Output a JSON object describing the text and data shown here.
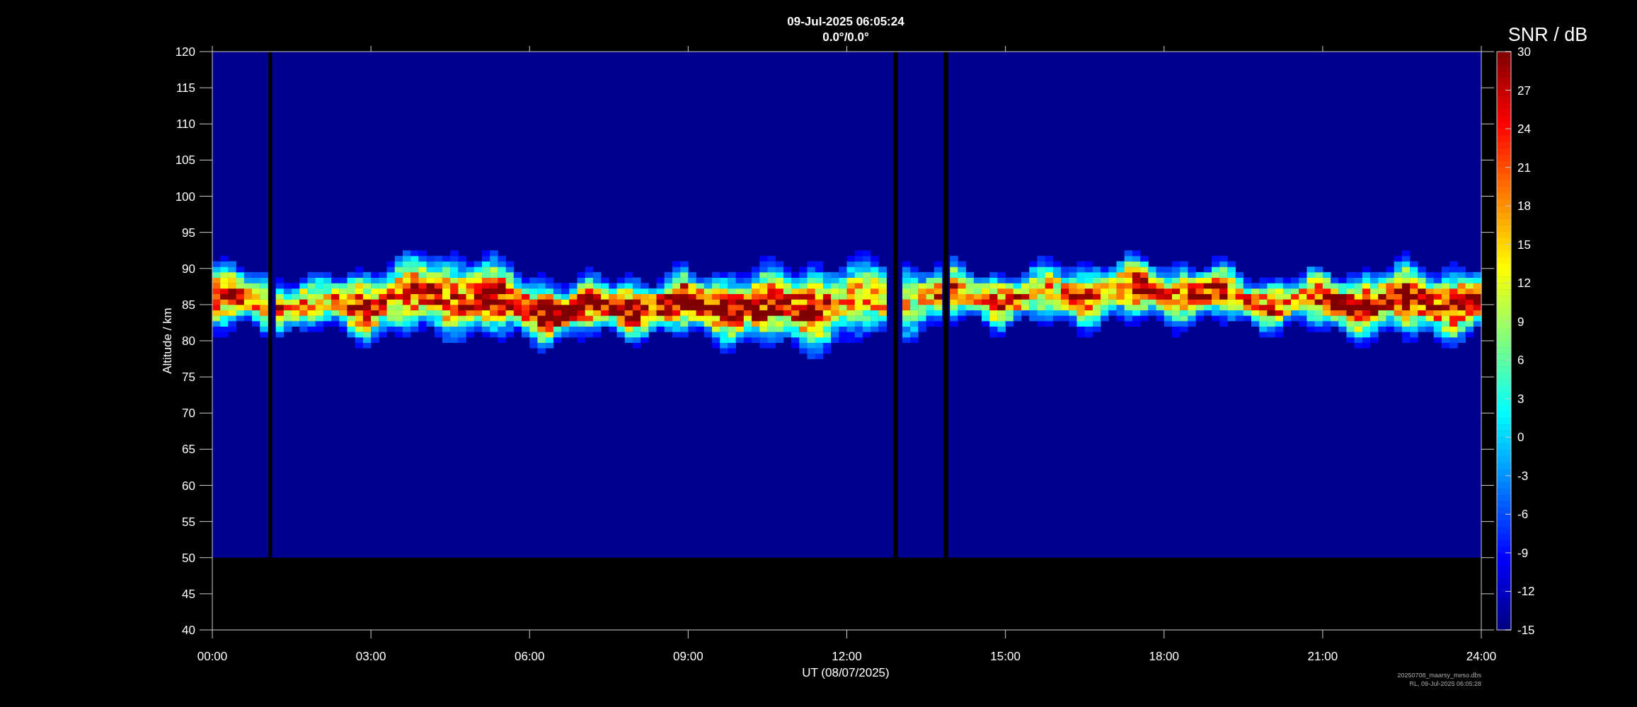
{
  "title": {
    "line_1": "09-Jul-2025 06:05:24",
    "line_2": "0.0°/0.0°"
  },
  "y_axis": {
    "label": "Altitude / km",
    "ticks": [
      "120",
      "115",
      "110",
      "105",
      "100",
      "95",
      "90",
      "85",
      "80",
      "75",
      "70",
      "65",
      "60",
      "55",
      "50",
      "45",
      "40"
    ]
  },
  "x_axis": {
    "label": "UT (08/07/2025)",
    "ticks": [
      "00:00",
      "03:00",
      "06:00",
      "09:00",
      "12:00",
      "15:00",
      "18:00",
      "21:00",
      "24:00"
    ]
  },
  "colorbar": {
    "label": "SNR / dB",
    "ticks": [
      "30",
      "27",
      "24",
      "21",
      "18",
      "15",
      "12",
      "9",
      "6",
      "3",
      "0",
      "-3",
      "-6",
      "-9",
      "-12",
      "-15"
    ]
  },
  "footnote": {
    "line_1": "20250708_maarsy_meso.dbs",
    "line_2": "RL, 09-Jul-2025 06:05:28"
  }
}
